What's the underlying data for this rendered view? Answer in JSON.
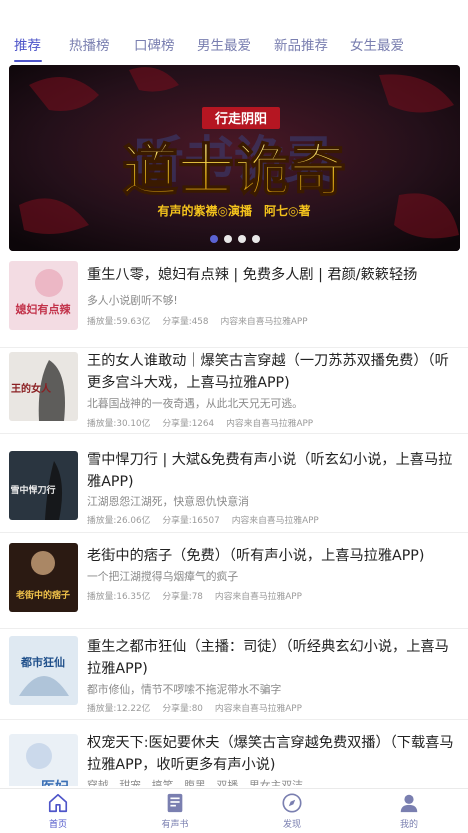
{
  "tabs": [
    {
      "label": "推荐",
      "active": true
    },
    {
      "label": "热播榜"
    },
    {
      "label": "口碑榜"
    },
    {
      "label": "男生最爱"
    },
    {
      "label": "新品推荐"
    },
    {
      "label": "女生最爱"
    }
  ],
  "banner": {
    "subtitle": "行走阴阳",
    "title": "道士诡奇",
    "credits": "有声的紫襟◎演播　阿七◎著",
    "bg_text": "听书诡灵",
    "dots": 4,
    "active_dot": 0
  },
  "items": [
    {
      "title": "重生八零，媳妇有点辣 | 免费多人剧 | 君颜/簌簌轻扬",
      "desc": "多人小说剧听不够!",
      "plays": "播放量:59.63亿",
      "shares": "分享量:458",
      "source": "内容来自喜马拉雅APP"
    },
    {
      "title": "王的女人谁敢动｜爆笑古言穿越（一刀苏苏双播免费）（听更多宫斗大戏，上喜马拉雅APP)",
      "desc": "北暮国战神的一夜奇遇，从此北天兄无可逃。",
      "plays": "播放量:30.10亿",
      "shares": "分享量:1264",
      "source": "内容来自喜马拉雅APP"
    },
    {
      "title": "雪中悍刀行 | 大斌&免费有声小说（听玄幻小说，上喜马拉雅APP)",
      "desc": "江湖恩怨江湖死，快意恩仇快意消",
      "plays": "播放量:26.06亿",
      "shares": "分享量:16507",
      "source": "内容来自喜马拉雅APP"
    },
    {
      "title": "老街中的痞子（免费）（听有声小说，上喜马拉雅APP)",
      "desc": "一个把江湖搅得乌烟瘴气的疯子",
      "plays": "播放量:16.35亿",
      "shares": "分享量:78",
      "source": "内容来自喜马拉雅APP"
    },
    {
      "title": "重生之都市狂仙（主播：司徒）（听经典玄幻小说，上喜马拉雅APP)",
      "desc": "都市修仙，情节不啰嗦不拖泥带水不骗字",
      "plays": "播放量:12.22亿",
      "shares": "分享量:80",
      "source": "内容来自喜马拉雅APP"
    },
    {
      "title": "权宠天下:医妃要休夫（爆笑古言穿越免费双播）（下载喜马拉雅APP，收听更多有声小说)",
      "desc": "穿越　甜宠　搞笑　腹黑　双播　男女主双洁",
      "plays": "",
      "shares": "",
      "source": ""
    }
  ],
  "covers": [
    {
      "text": "媳妇有点辣",
      "bg": "#f3dce3",
      "fg": "#c2324a"
    },
    {
      "text": "王的女人",
      "bg": "#e9e6e2",
      "fg": "#8a1f22"
    },
    {
      "text": "雪中悍刀行",
      "bg": "#2a3540",
      "fg": "#e8e8e8"
    },
    {
      "text": "老街中的痞子",
      "bg": "#2b1a12",
      "fg": "#f0c24a"
    },
    {
      "text": "都市狂仙",
      "bg": "#dfe9f2",
      "fg": "#1f4f8a"
    },
    {
      "text": "医妃",
      "bg": "#eaf0f6",
      "fg": "#3a6fb5"
    }
  ],
  "bottom_nav": [
    {
      "label": "首页",
      "icon": "home-icon",
      "active": true
    },
    {
      "label": "有声书",
      "icon": "book-icon"
    },
    {
      "label": "发现",
      "icon": "compass-icon"
    },
    {
      "label": "我的",
      "icon": "user-icon"
    }
  ],
  "colors": {
    "accent": "#4e55c9",
    "tab_inactive": "#7a7fb0"
  }
}
